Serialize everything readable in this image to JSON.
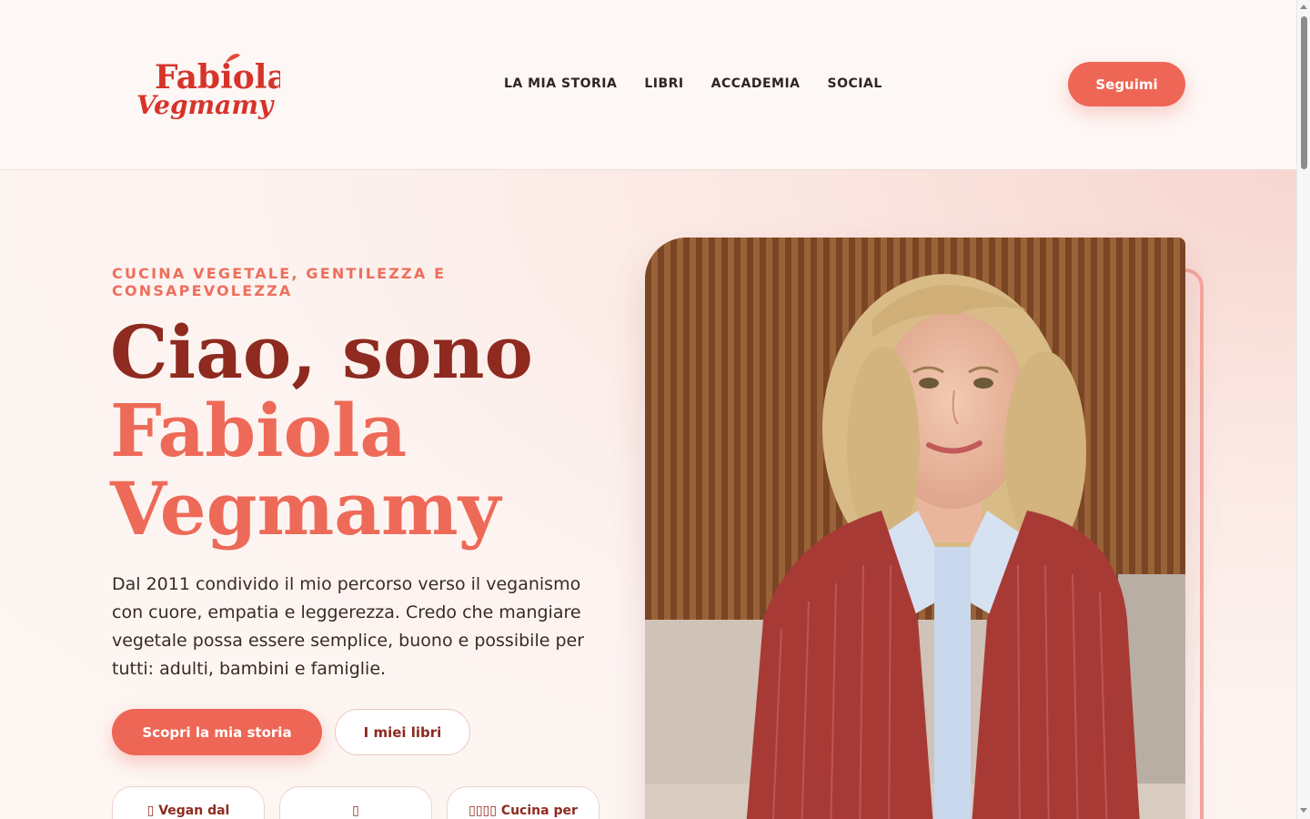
{
  "header": {
    "logo_line1": "Fabiola",
    "logo_line2": "Vegmamy",
    "nav": [
      "LA MIA STORIA",
      "LIBRI",
      "ACCADEMIA",
      "SOCIAL"
    ],
    "follow_label": "Seguimi"
  },
  "hero": {
    "eyebrow": "CUCINA VEGETALE, GENTILEZZA E CONSAPEVOLEZZA",
    "headline_line1": "Ciao, sono",
    "headline_line2": "Fabiola",
    "headline_line3": "Vegmamy",
    "intro": "Dal 2011 condivido il mio percorso verso il veganismo con cuore, empatia e leggerezza. Credo che mangiare vegetale possa essere semplice, buono e possibile per tutti: adulti, bambini e famiglie.",
    "cta_primary": "Scopri la mia storia",
    "cta_secondary": "I miei libri",
    "chips": [
      "▯ Vegan dal",
      "▯",
      "▯▯▯▯ Cucina per"
    ]
  },
  "colors": {
    "accent": "#ee6655",
    "brand_dark": "#8e2a1f",
    "background": "#fdf6f3"
  }
}
